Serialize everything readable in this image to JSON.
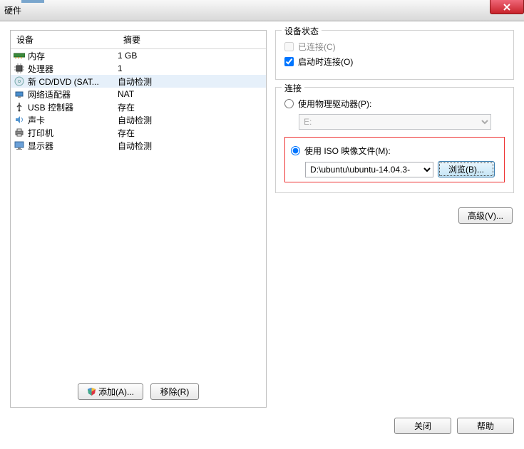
{
  "window": {
    "title": "硬件"
  },
  "list": {
    "col_device": "设备",
    "col_summary": "摘要",
    "rows": [
      {
        "name": "内存",
        "summary": "1 GB"
      },
      {
        "name": "处理器",
        "summary": "1"
      },
      {
        "name": "新 CD/DVD (SAT...",
        "summary": "自动检测"
      },
      {
        "name": "网络适配器",
        "summary": "NAT"
      },
      {
        "name": "USB 控制器",
        "summary": "存在"
      },
      {
        "name": "声卡",
        "summary": "自动检测"
      },
      {
        "name": "打印机",
        "summary": "存在"
      },
      {
        "name": "显示器",
        "summary": "自动检测"
      }
    ],
    "add_btn": "添加(A)...",
    "remove_btn": "移除(R)"
  },
  "status": {
    "legend": "设备状态",
    "connected": "已连接(C)",
    "connect_on_power": "启动时连接(O)"
  },
  "connection": {
    "legend": "连接",
    "use_physical": "使用物理驱动器(P):",
    "physical_value": "E:",
    "use_iso": "使用 ISO 映像文件(M):",
    "iso_value": "D:\\ubuntu\\ubuntu-14.04.3-",
    "browse": "浏览(B)...",
    "advanced": "高级(V)..."
  },
  "footer": {
    "close": "关闭",
    "help": "帮助"
  }
}
